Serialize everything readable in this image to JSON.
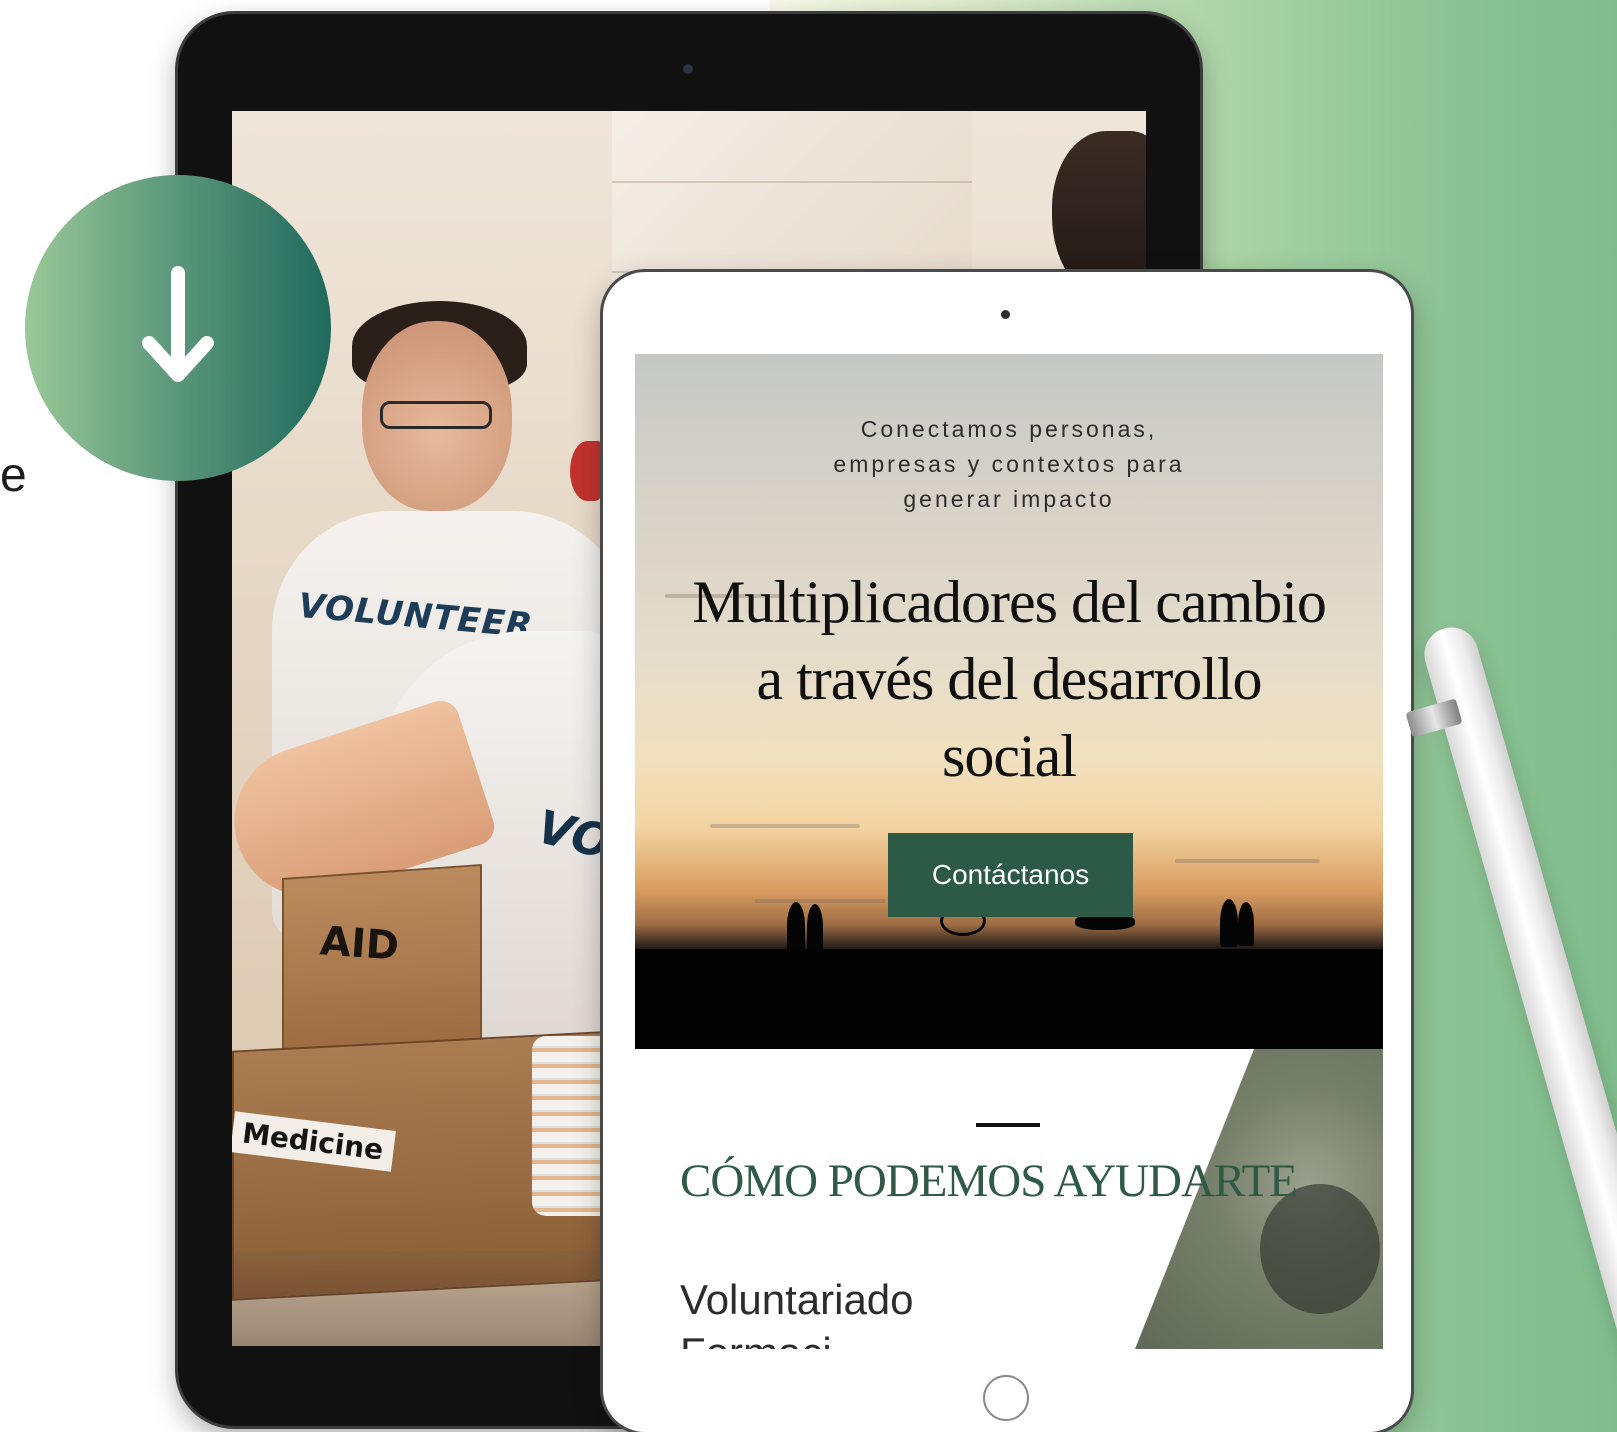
{
  "left_fragment_text": "e",
  "tablet_front": {
    "hero": {
      "tagline": "Conectamos personas,\nempresas y contextos para\ngenerar impacto",
      "title": "Multiplicadores del cambio a través del desarrollo social",
      "cta_label": "Contáctanos"
    },
    "help_section": {
      "title": "CÓMO PODEMOS AYUDARTE",
      "items": [
        "Voluntariado",
        "Formaci"
      ]
    }
  },
  "tablet_back_photo": {
    "shirt_text_1": "VOLUNTEER",
    "shirt_text_2": "VOL",
    "box_label_1": "AID",
    "box_label_2": "Medicine"
  },
  "icons": {
    "download": "arrow-down-icon",
    "home": "home-button-icon",
    "camera": "camera-dot-icon"
  },
  "colors": {
    "accent_green": "#2c5a47",
    "download_gradient_start": "#9ac898",
    "download_gradient_end": "#1f6a5d",
    "background_panel_green": "#8cc394"
  }
}
